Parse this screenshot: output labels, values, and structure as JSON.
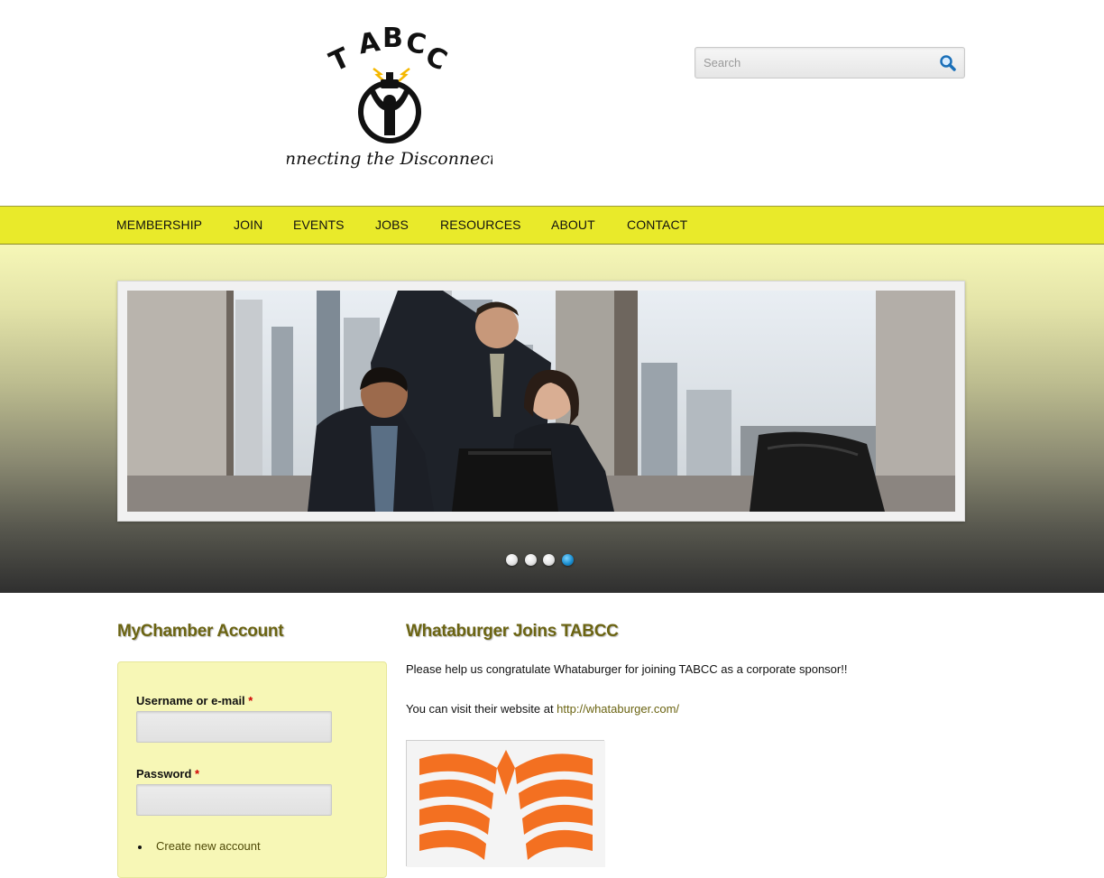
{
  "header": {
    "logo": {
      "letters": "TABCC",
      "tagline": "Connecting the Disconnected"
    },
    "search": {
      "placeholder": "Search",
      "value": "",
      "icon": "search-icon"
    }
  },
  "nav": {
    "items": [
      {
        "label": "MEMBERSHIP"
      },
      {
        "label": "JOIN"
      },
      {
        "label": "EVENTS"
      },
      {
        "label": "JOBS"
      },
      {
        "label": "RESOURCES"
      },
      {
        "label": "ABOUT"
      },
      {
        "label": "CONTACT"
      }
    ]
  },
  "slideshow": {
    "slide_count": 4,
    "active_slide": 4
  },
  "sidebar": {
    "title": "MyChamber Account",
    "username_label": "Username or e-mail",
    "password_label": "Password",
    "required_mark": "*",
    "username_value": "",
    "password_value": "",
    "create_account": "Create new account"
  },
  "article": {
    "title": "Whataburger Joins TABCC",
    "paragraph1": "Please help us congratulate Whataburger for joining TABCC as a corporate sponsor!!",
    "paragraph2_prefix": "You can visit their website at ",
    "link": "http://whataburger.com/"
  },
  "colors": {
    "nav_bg": "#e9ea2a",
    "login_bg": "#f7f7b6",
    "title": "#6b6412",
    "active_dot": "#1c8fd0",
    "logo_orange": "#f37021"
  }
}
